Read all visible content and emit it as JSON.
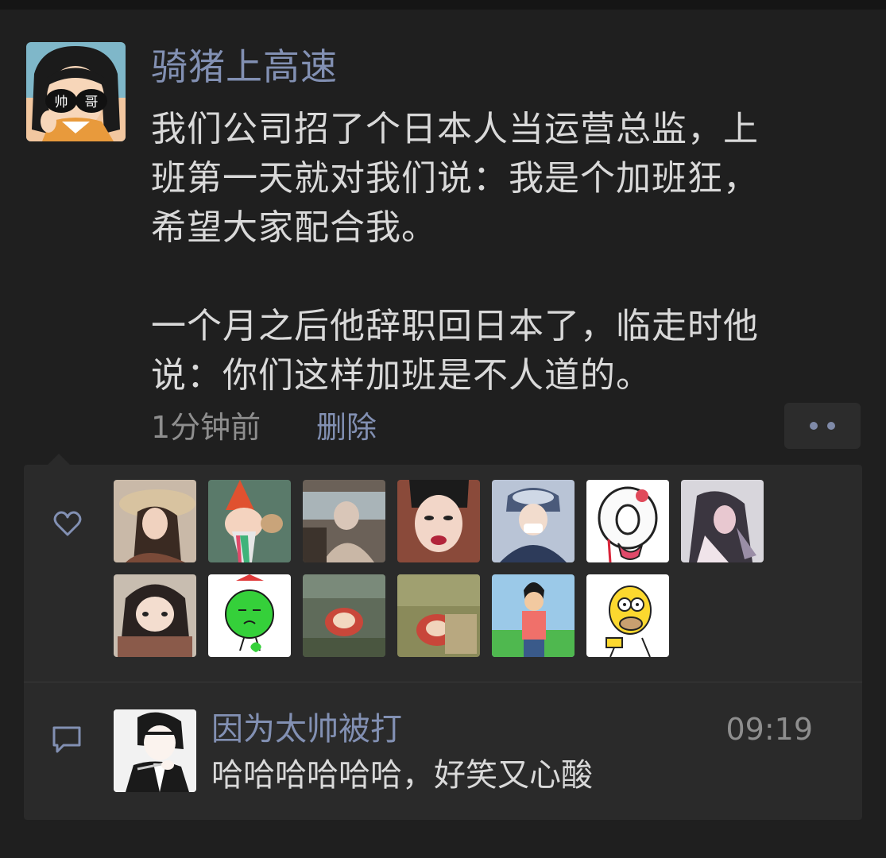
{
  "post": {
    "author": "骑猪上高速",
    "avatar_text_left": "帅",
    "avatar_text_right": "哥",
    "body": [
      "我们公司招了个日本人当运营总监，上",
      "班第一天就对我们说：我是个加班狂，",
      "希望大家配合我。",
      "一个月之后他辞职回日本了，临走时他",
      "说：你们这样加班是不人道的。"
    ],
    "time": "1分钟前",
    "delete_label": "删除"
  },
  "icons": {
    "like": "heart-outline-icon",
    "comment": "speech-bubble-icon",
    "more": "ellipsis-icon"
  },
  "likes": {
    "count_shown": 13
  },
  "comments": [
    {
      "author": "因为太帅被打",
      "time": "09:19",
      "text": "哈哈哈哈哈哈，好笑又心酸"
    }
  ],
  "colors": {
    "background": "#1f1f1f",
    "panel": "#2a2a2a",
    "name_link": "#8290b3",
    "body_text": "#d9d9d9",
    "meta_text": "#8e8e8e"
  }
}
